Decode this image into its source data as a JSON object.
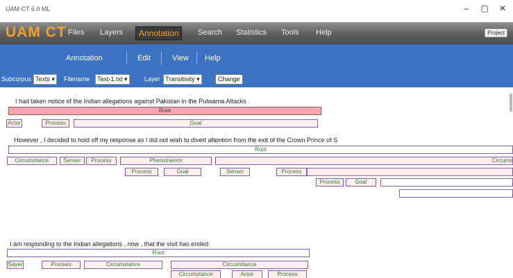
{
  "window": {
    "title": "UAM CT 6.0 ML",
    "controls": [
      "–",
      "▢",
      "✕"
    ]
  },
  "menubar": {
    "brand": "UAM CT",
    "items": [
      "Files",
      "Layers",
      "Annotation",
      "Search",
      "Statistics",
      "Tools",
      "Help"
    ],
    "active_item": "Annotation",
    "project_button": "Project"
  },
  "submenu": {
    "items": [
      "Annotation",
      "Edit",
      "View",
      "Help"
    ]
  },
  "controls": {
    "subcorpus_label": "Subcorpus",
    "subcorpus_value": "Texts",
    "filename_label": "Filename",
    "filename_value": "Text-1.txt",
    "layer_label": "Layer",
    "layer_value": "Transitivity",
    "change_button": "Change"
  },
  "sentences": [
    {
      "text": "I   had   taken   notice of the Indian allegations against Pakistan in the Pulwama Attacks",
      "boxes": [
        "Root",
        "Actor",
        "Process",
        "Goal"
      ]
    },
    {
      "text": "However   ,   I   decided  to   hold   off my response   as   I   did not   wish   to   divert   attention   from the exit of the Crown Prince of S",
      "boxes": [
        "Root",
        "Circumstance",
        "Senser",
        "Process",
        "Phenomenon",
        "Circums",
        "Process",
        "Goal",
        "Senser",
        "Process",
        "Process",
        "Goal"
      ]
    },
    {
      "text": "I   am responding  to the Indian allegations   ,   now   ,   that the visit has  ended",
      "boxes": [
        "Root",
        "Sayer",
        "Process",
        "Circumstance",
        "Circumstance",
        "Circumstance",
        "Actor",
        "Process"
      ]
    }
  ]
}
